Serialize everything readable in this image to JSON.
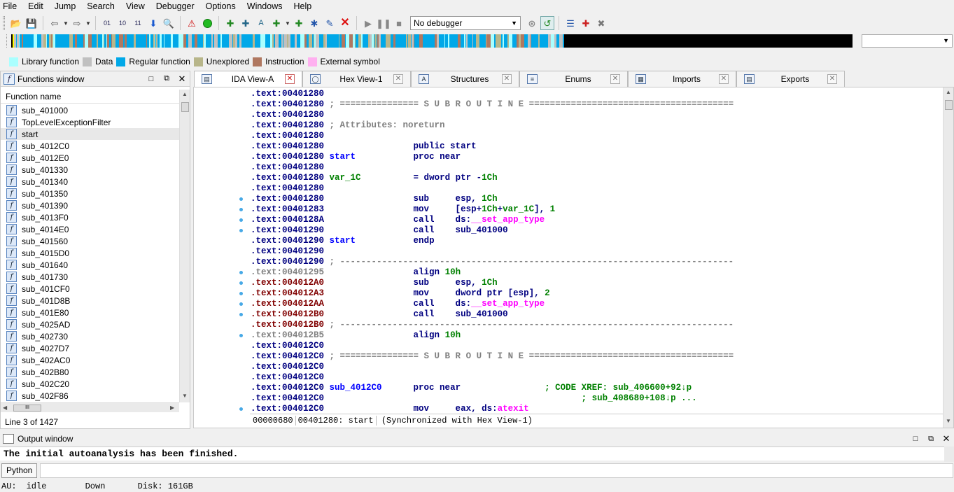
{
  "menu": [
    "File",
    "Edit",
    "Jump",
    "Search",
    "View",
    "Debugger",
    "Options",
    "Windows",
    "Help"
  ],
  "toolbar": {
    "debugger_select": "No debugger",
    "icons": [
      "open-icon",
      "save-icon",
      "back-icon",
      "forward-icon",
      "nav-icon",
      "run-icon",
      "stop-icon"
    ]
  },
  "legend": [
    {
      "label": "Library function",
      "color": "#aaffff"
    },
    {
      "label": "Data",
      "color": "#c0c0c0"
    },
    {
      "label": "Regular function",
      "color": "#00a8e8"
    },
    {
      "label": "Unexplored",
      "color": "#b8b68a"
    },
    {
      "label": "Instruction",
      "color": "#b07860"
    },
    {
      "label": "External symbol",
      "color": "#ffb0f0"
    }
  ],
  "functions_window": {
    "title": "Functions window",
    "column_header": "Function name",
    "functions": [
      "sub_401000",
      "TopLevelExceptionFilter",
      "start",
      "sub_4012C0",
      "sub_4012E0",
      "sub_401330",
      "sub_401340",
      "sub_401350",
      "sub_401390",
      "sub_4013F0",
      "sub_4014E0",
      "sub_401560",
      "sub_4015D0",
      "sub_401640",
      "sub_401730",
      "sub_401CF0",
      "sub_401D8B",
      "sub_401E80",
      "sub_4025AD",
      "sub_402730",
      "sub_4027D7",
      "sub_402AC0",
      "sub_402B80",
      "sub_402C20",
      "sub_402F86"
    ],
    "selected_index": 2,
    "status": "Line 3 of 1427"
  },
  "tabs": [
    {
      "label": "IDA View-A",
      "icon": "ida-view-icon",
      "active": true
    },
    {
      "label": "Hex View-1",
      "icon": "hex-view-icon",
      "active": false
    },
    {
      "label": "Structures",
      "icon": "structures-icon",
      "active": false
    },
    {
      "label": "Enums",
      "icon": "enums-icon",
      "active": false
    },
    {
      "label": "Imports",
      "icon": "imports-icon",
      "active": false
    },
    {
      "label": "Exports",
      "icon": "exports-icon",
      "active": false
    }
  ],
  "disassembly": [
    {
      "addr": ".text:00401280",
      "style": "addr",
      "segs": []
    },
    {
      "addr": ".text:00401280",
      "style": "addr",
      "segs": [
        {
          "t": " ; =============== S U B R O U T I N E =======================================",
          "c": "gray"
        }
      ]
    },
    {
      "addr": ".text:00401280",
      "style": "addr",
      "segs": []
    },
    {
      "addr": ".text:00401280",
      "style": "addr",
      "segs": [
        {
          "t": " ; Attributes: noreturn",
          "c": "gray"
        }
      ]
    },
    {
      "addr": ".text:00401280",
      "style": "addr",
      "segs": []
    },
    {
      "addr": ".text:00401280",
      "style": "addr",
      "segs": [
        {
          "t": "                 public start",
          "c": "kw"
        }
      ]
    },
    {
      "addr": ".text:00401280",
      "style": "addr",
      "segs": [
        {
          "t": " start",
          "c": "name"
        },
        {
          "t": "           proc near",
          "c": "kw"
        }
      ]
    },
    {
      "addr": ".text:00401280",
      "style": "addr",
      "segs": []
    },
    {
      "addr": ".text:00401280",
      "style": "addr",
      "segs": [
        {
          "t": " var_1C",
          "c": "num"
        },
        {
          "t": "          = dword ptr -",
          "c": "kw"
        },
        {
          "t": "1Ch",
          "c": "num"
        }
      ]
    },
    {
      "addr": ".text:00401280",
      "style": "addr",
      "segs": []
    },
    {
      "addr": ".text:00401280",
      "style": "addr",
      "segs": [
        {
          "t": "                 sub     esp, ",
          "c": "kw"
        },
        {
          "t": "1Ch",
          "c": "num"
        }
      ]
    },
    {
      "addr": ".text:00401283",
      "style": "addr",
      "segs": [
        {
          "t": "                 mov     [esp+",
          "c": "kw"
        },
        {
          "t": "1Ch",
          "c": "num"
        },
        {
          "t": "+",
          "c": "kw"
        },
        {
          "t": "var_1C",
          "c": "num"
        },
        {
          "t": "], ",
          "c": "kw"
        },
        {
          "t": "1",
          "c": "num"
        }
      ]
    },
    {
      "addr": ".text:0040128A",
      "style": "addr",
      "segs": [
        {
          "t": "                 call    ds:",
          "c": "kw"
        },
        {
          "t": "__set_app_type",
          "c": "ext"
        }
      ]
    },
    {
      "addr": ".text:00401290",
      "style": "addr",
      "segs": [
        {
          "t": "                 call    sub_401000",
          "c": "kw"
        }
      ]
    },
    {
      "addr": ".text:00401290",
      "style": "addr",
      "segs": [
        {
          "t": " start",
          "c": "name"
        },
        {
          "t": "           endp",
          "c": "kw"
        }
      ]
    },
    {
      "addr": ".text:00401290",
      "style": "addr",
      "segs": []
    },
    {
      "addr": ".text:00401290",
      "style": "addr",
      "segs": [
        {
          "t": " ; ---------------------------------------------------------------------------",
          "c": "gray"
        }
      ]
    },
    {
      "addr": ".text:00401295",
      "style": "gray",
      "segs": [
        {
          "t": "                 align ",
          "c": "kw"
        },
        {
          "t": "10h",
          "c": "num"
        }
      ]
    },
    {
      "addr": ".text:004012A0",
      "style": "red",
      "segs": [
        {
          "t": "                 sub     esp, ",
          "c": "kw"
        },
        {
          "t": "1Ch",
          "c": "num"
        }
      ]
    },
    {
      "addr": ".text:004012A3",
      "style": "red",
      "segs": [
        {
          "t": "                 mov     dword ptr [esp], ",
          "c": "kw"
        },
        {
          "t": "2",
          "c": "num"
        }
      ]
    },
    {
      "addr": ".text:004012AA",
      "style": "red",
      "segs": [
        {
          "t": "                 call    ds:",
          "c": "kw"
        },
        {
          "t": "__set_app_type",
          "c": "ext"
        }
      ]
    },
    {
      "addr": ".text:004012B0",
      "style": "red",
      "segs": [
        {
          "t": "                 call    sub_401000",
          "c": "kw"
        }
      ]
    },
    {
      "addr": ".text:004012B0",
      "style": "red",
      "segs": [
        {
          "t": " ; ---------------------------------------------------------------------------",
          "c": "gray"
        }
      ]
    },
    {
      "addr": ".text:004012B5",
      "style": "gray",
      "segs": [
        {
          "t": "                 align ",
          "c": "kw"
        },
        {
          "t": "10h",
          "c": "num"
        }
      ]
    },
    {
      "addr": ".text:004012C0",
      "style": "addr",
      "segs": []
    },
    {
      "addr": ".text:004012C0",
      "style": "addr",
      "segs": [
        {
          "t": " ; =============== S U B R O U T I N E =======================================",
          "c": "gray"
        }
      ]
    },
    {
      "addr": ".text:004012C0",
      "style": "addr",
      "segs": []
    },
    {
      "addr": ".text:004012C0",
      "style": "addr",
      "segs": []
    },
    {
      "addr": ".text:004012C0",
      "style": "addr",
      "segs": [
        {
          "t": " sub_4012C0",
          "c": "name"
        },
        {
          "t": "      proc near",
          "c": "kw"
        },
        {
          "t": "                ; CODE XREF: sub_406600+92↓p",
          "c": "num"
        }
      ]
    },
    {
      "addr": ".text:004012C0",
      "style": "addr",
      "segs": [
        {
          "t": "                                                 ; sub_408680+108↓p ...",
          "c": "num"
        }
      ]
    },
    {
      "addr": ".text:004012C0",
      "style": "addr",
      "segs": [
        {
          "t": "                 mov     eax, ds:",
          "c": "kw"
        },
        {
          "t": "atexit",
          "c": "ext"
        }
      ]
    }
  ],
  "gutter_dot_lines": [
    10,
    11,
    12,
    13,
    17,
    18,
    19,
    20,
    21,
    23,
    30
  ],
  "ida_status": {
    "offset": "00000680",
    "location": "00401280: start",
    "sync": "(Synchronized with Hex View-1)"
  },
  "output": {
    "title": "Output window",
    "text": "The initial autoanalysis has been finished.",
    "python_button": "Python"
  },
  "statusbar": {
    "au_label": "AU:",
    "au_state": "idle",
    "direction": "Down",
    "disk": "Disk: 161GB"
  }
}
